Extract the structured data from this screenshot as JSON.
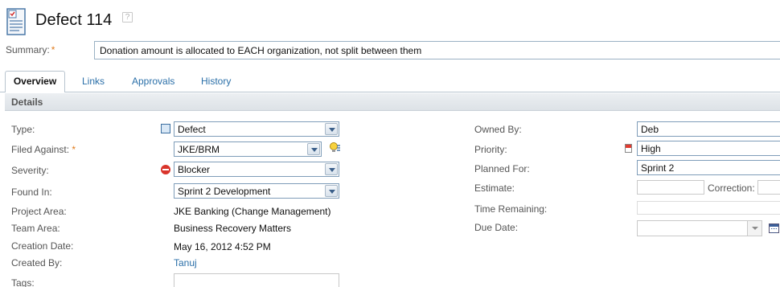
{
  "header": {
    "title": "Defect 114",
    "help": "?"
  },
  "summary": {
    "label": "Summary:",
    "required": "*",
    "value": "Donation amount is allocated to EACH organization, not split between them"
  },
  "tabs": [
    {
      "label": "Overview"
    },
    {
      "label": "Links"
    },
    {
      "label": "Approvals"
    },
    {
      "label": "History"
    }
  ],
  "section": {
    "title": "Details"
  },
  "left": {
    "type": {
      "label": "Type:",
      "value": "Defect"
    },
    "filed_against": {
      "label": "Filed Against:",
      "required": "*",
      "value": "JKE/BRM"
    },
    "severity": {
      "label": "Severity:",
      "value": "Blocker"
    },
    "found_in": {
      "label": "Found In:",
      "value": "Sprint 2 Development"
    },
    "project_area": {
      "label": "Project Area:",
      "value": "JKE Banking (Change Management)"
    },
    "team_area": {
      "label": "Team Area:",
      "value": "Business Recovery Matters"
    },
    "creation_date": {
      "label": "Creation Date:",
      "value": "May 16, 2012 4:52 PM"
    },
    "created_by": {
      "label": "Created By:",
      "value": "Tanuj"
    },
    "tags": {
      "label": "Tags:",
      "value": ""
    }
  },
  "right": {
    "owned_by": {
      "label": "Owned By:",
      "value": "Deb"
    },
    "priority": {
      "label": "Priority:",
      "value": "High"
    },
    "planned_for": {
      "label": "Planned For:",
      "value": "Sprint 2"
    },
    "estimate": {
      "label": "Estimate:",
      "value": ""
    },
    "correction": {
      "label": "Correction:",
      "value": ""
    },
    "time_remaining": {
      "label": "Time Remaining:",
      "value": ""
    },
    "due_date": {
      "label": "Due Date:",
      "value": ""
    }
  },
  "icons": {
    "type": "defect-type-icon",
    "severity": "blocker-icon",
    "priority": "priority-high-icon",
    "filed_against_action": "lightbulb-icon",
    "due_date_picker": "calendar-icon"
  }
}
